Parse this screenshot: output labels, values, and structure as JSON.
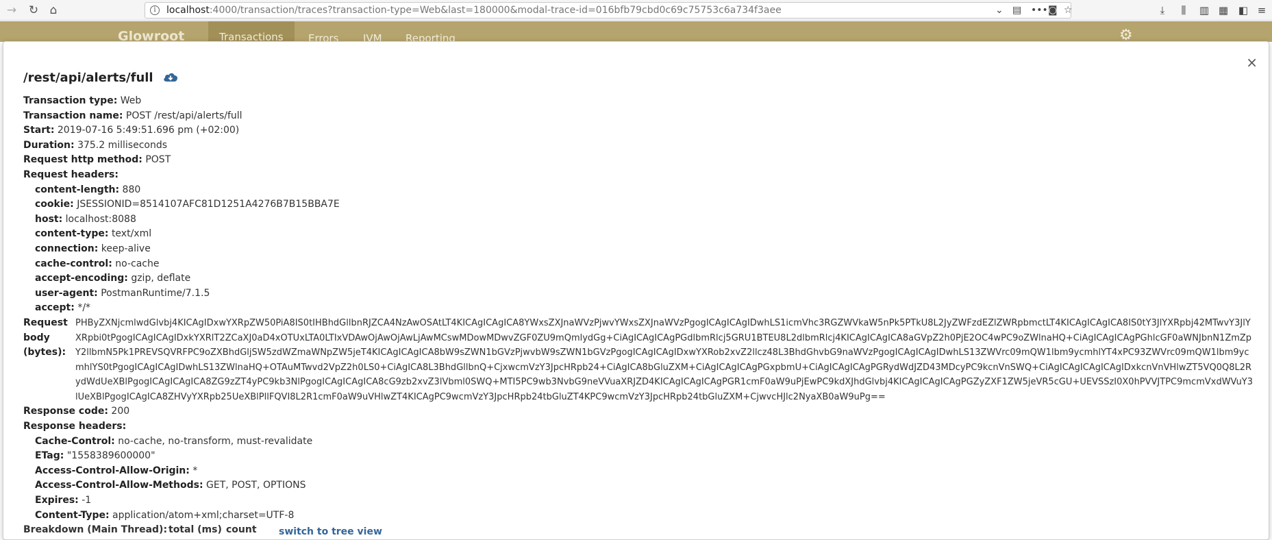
{
  "browser": {
    "url_host": "localhost",
    "url_rest": ":4000/transaction/traces?transaction-type=Web&last=180000&modal-trace-id=016bfb79cbd0c69c75753c6a734f3aee"
  },
  "navbar": {
    "brand": "Glowroot",
    "tabs": [
      "Transactions",
      "Errors",
      "JVM",
      "Reporting"
    ]
  },
  "modal": {
    "title": "/rest/api/alerts/full",
    "close_label": "×",
    "fields": [
      {
        "label": "Transaction type:",
        "value": "Web"
      },
      {
        "label": "Transaction name:",
        "value": "POST /rest/api/alerts/full"
      },
      {
        "label": "Start:",
        "value": "2019-07-16 5:49:51.696 pm (+02:00)"
      },
      {
        "label": "Duration:",
        "value": "375.2 milliseconds"
      },
      {
        "label": "Request http method:",
        "value": "POST"
      }
    ],
    "request_headers_label": "Request headers:",
    "request_headers": [
      {
        "label": "content-length:",
        "value": "880"
      },
      {
        "label": "cookie:",
        "value": "JSESSIONID=8514107AFC81D1251A4276B7B15BBA7E"
      },
      {
        "label": "host:",
        "value": "localhost:8088"
      },
      {
        "label": "content-type:",
        "value": "text/xml"
      },
      {
        "label": "connection:",
        "value": "keep-alive"
      },
      {
        "label": "cache-control:",
        "value": "no-cache"
      },
      {
        "label": "accept-encoding:",
        "value": "gzip, deflate"
      },
      {
        "label": "user-agent:",
        "value": "PostmanRuntime/7.1.5"
      },
      {
        "label": "accept:",
        "value": "*/*"
      }
    ],
    "request_body_label": "Request body (bytes):",
    "request_body": "PHByZXNjcmlwdGlvbj4KICAgIDxwYXRpZW50PiA8IS0tIHBhdGllbnRJZCA4NzAwOSAtLT4KICAgICAgICA8YWxsZXJnaWVzPjwvYWxsZXJnaWVzPgogICAgICAgIDwhLS1icmVhc3RGZWVkaW5nPk5PTkU8L2JyZWFzdEZlZWRpbmctLT4KICAgICAgICA8IS0tY3JlYXRpbj42MTwvY3JlYXRpbi0tPgogICAgICAgIDxkYXRlT2ZCaXJ0aD4xOTUxLTA0LTIxVDAwOjAwOjAwLjAwMCswMDowMDwvZGF0ZU9mQmlydGg+CiAgICAgICAgPGdlbmRlcj5GRU1BTEU8L2dlbmRlcj4KICAgICAgICA8aGVpZ2h0PjE2OC4wPC9oZWlnaHQ+CiAgICAgICAgPGhlcGF0aWNJbnN1ZmZpY2llbmN5Pk1PREVSQVRFPC9oZXBhdGljSW5zdWZmaWNpZW5jeT4KICAgICAgICA8bW9sZWN1bGVzPjwvbW9sZWN1bGVzPgogICAgICAgIDxwYXRob2xvZ2llcz48L3BhdGhvbG9naWVzPgogICAgICAgIDwhLS13ZWVrc09mQW1lbm9ycmhlYT4xPC93ZWVrc09mQW1lbm9ycmhlYS0tPgogICAgICAgIDwhLS13ZWlnaHQ+OTAuMTwvd2VpZ2h0LS0+CiAgICA8L3BhdGllbnQ+CjxwcmVzY3JpcHRpb24+CiAgICA8bGluZXM+CiAgICAgICAgPGxpbmU+CiAgICAgICAgPGRydWdJZD43MDcyPC9kcnVnSWQ+CiAgICAgICAgICAgIDxkcnVnVHlwZT5VQ0Q8L2RydWdUeXBlPgogICAgICAgICA8ZG9zZT4yPC9kb3NlPgogICAgICAgICA8cG9zb2xvZ3lVbml0SWQ+MTI5PC9wb3NvbG9neVVuaXRJZD4KICAgICAgICAgPGR1cmF0aW9uPjEwPC9kdXJhdGlvbj4KICAgICAgICAgPGZyZXF1ZW5jeVR5cGU+UEVSSzI0X0hPVVJTPC9mcmVxdWVuY3lUeXBlPgogICAgICA8ZHVyYXRpb25UeXBlPllFQVI8L2R1cmF0aW9uVHlwZT4KICAgPC9wcmVzY3JpcHRpb24tbGluZT4KPC9wcmVzY3JpcHRpb24tbGluZXM+CjwvcHJlc2NyaXB0aW9uPg==",
    "response_code_label": "Response code:",
    "response_code": "200",
    "response_headers_label": "Response headers:",
    "response_headers": [
      {
        "label": "Cache-Control:",
        "value": "no-cache, no-transform, must-revalidate"
      },
      {
        "label": "ETag:",
        "value": "\"1558389600000\""
      },
      {
        "label": "Access-Control-Allow-Origin:",
        "value": "*"
      },
      {
        "label": "Access-Control-Allow-Methods:",
        "value": "GET, POST, OPTIONS"
      },
      {
        "label": "Expires:",
        "value": "-1"
      },
      {
        "label": "Content-Type:",
        "value": "application/atom+xml;charset=UTF-8"
      }
    ],
    "breakdown": {
      "label": "Breakdown (Main Thread):",
      "col_total": "total (ms)",
      "col_count": "count",
      "switch_link": "switch to tree view"
    }
  }
}
